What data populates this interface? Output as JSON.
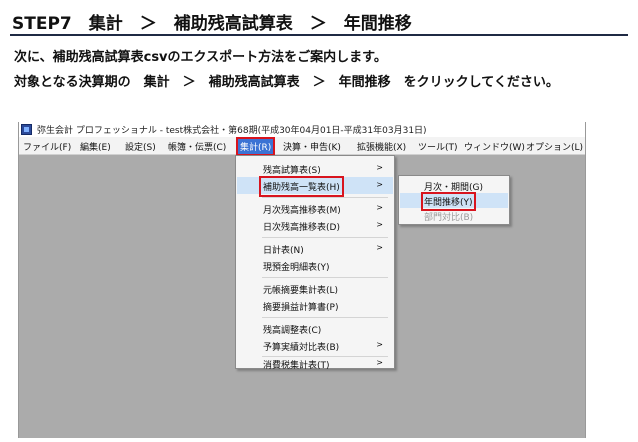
{
  "header": {
    "title": "STEP7　集計　＞　補助残高試算表　＞　年間推移"
  },
  "instructions": {
    "line1": "次に、補助残高試算表csvのエクスポート方法をご案内します。",
    "line2": "対象となる決算期の　集計　＞　補助残高試算表　＞　年間推移　をクリックしてください。"
  },
  "window": {
    "title": "弥生会計 プロフェッショナル - test株式会社・第68期(平成30年04月01日-平成31年03月31日)",
    "menubar": [
      "ファイル(F)",
      "編集(E)",
      "設定(S)",
      "帳簿・伝票(C)",
      "集計(R)",
      "決算・申告(K)",
      "拡張機能(X)",
      "ツール(T)",
      "ウィンドウ(W)",
      "オプション(L)"
    ],
    "dropdown": [
      "残高試算表(S)",
      "補助残高一覧表(H)",
      "月次残高推移表(M)",
      "日次残高推移表(D)",
      "日計表(N)",
      "現預金明細表(Y)",
      "元帳摘要集計表(L)",
      "摘要損益計算書(P)",
      "残高調整表(C)",
      "予算実績対比表(B)",
      "消費税集計表(T)"
    ],
    "submenu": [
      "月次・期間(G)",
      "年間推移(Y)",
      "部門対比(B)"
    ]
  }
}
